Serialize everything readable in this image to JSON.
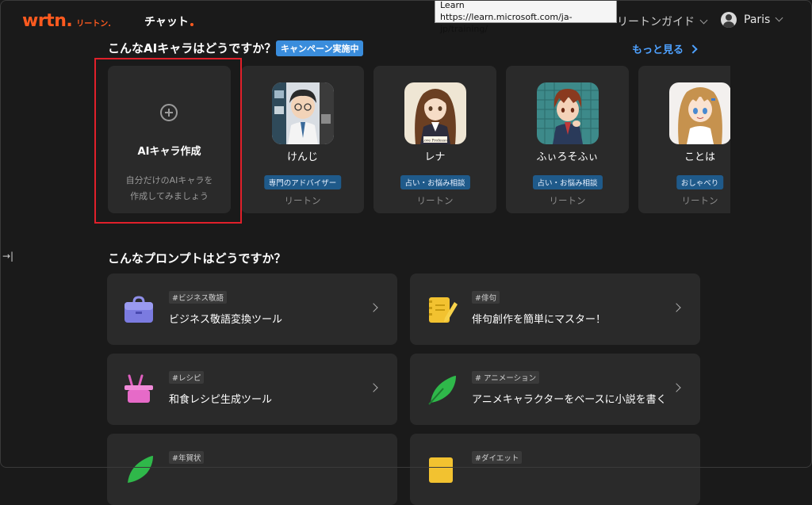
{
  "header": {
    "logo_text": "wrtn.",
    "logo_sub": "リートン.",
    "nav_chat": "チャット",
    "guide_label": "リートンガイド",
    "user_name": "Paris"
  },
  "tooltip": {
    "line1": "Learn",
    "line2": "https://learn.microsoft.com/ja-jp/training/"
  },
  "characters_section": {
    "title": "こんなAIキャラはどうですか？",
    "campaign_badge": "キャンペーン実施中",
    "more_link": "もっと見る",
    "create_card": {
      "title": "AIキャラ作成",
      "desc_line1": "自分だけのAIキャラを",
      "desc_line2": "作成してみましょう"
    },
    "cards": [
      {
        "name": "けんじ",
        "tag": "専門のアドバイザー",
        "author": "リートン"
      },
      {
        "name": "レナ",
        "tag": "占い・お悩み相談",
        "author": "リートン"
      },
      {
        "name": "ふぃろそふぃ",
        "tag": "占い・お悩み相談",
        "author": "リートン"
      },
      {
        "name": "ことは",
        "tag": "おしゃべり",
        "author": "リートン"
      }
    ]
  },
  "side_toggle": "→|",
  "prompts_section": {
    "title": "こんなプロンプトはどうですか？",
    "cards": [
      {
        "tag": "#ビジネス敬語",
        "title": "ビジネス敬語変換ツール"
      },
      {
        "tag": "#俳句",
        "title": "俳句創作を簡単にマスター！"
      },
      {
        "tag": "#レシピ",
        "title": "和食レシピ生成ツール"
      },
      {
        "tag": "# アニメーション",
        "title": "アニメキャラクターをベースに小説を書く"
      },
      {
        "tag": "#年賀状",
        "title": ""
      },
      {
        "tag": "#ダイエット",
        "title": ""
      }
    ]
  },
  "colors": {
    "brand": "#ff5a1f",
    "link": "#4ea1ff",
    "highlight": "#e0202a"
  }
}
